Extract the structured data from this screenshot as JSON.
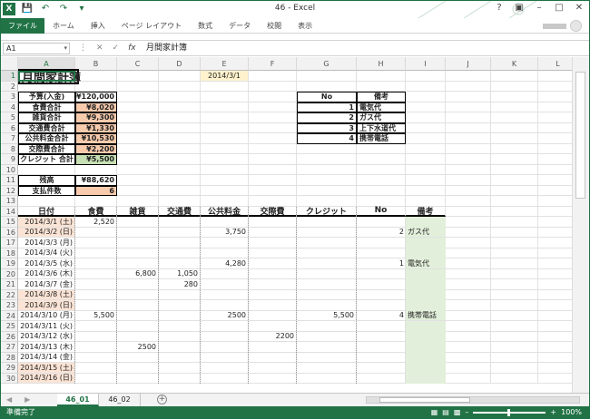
{
  "window": {
    "title": "46 - Excel"
  },
  "ribbon": {
    "tabs": [
      "ファイル",
      "ホーム",
      "挿入",
      "ページ レイアウト",
      "数式",
      "データ",
      "校閲",
      "表示"
    ]
  },
  "formula_bar": {
    "name_box": "A1",
    "formula": "月間家計簿"
  },
  "columns": [
    "A",
    "B",
    "C",
    "D",
    "E",
    "F",
    "G",
    "H",
    "I",
    "J",
    "K",
    "L"
  ],
  "sheet": {
    "title": "月間家計簿",
    "date": "2014/3/1",
    "summary": [
      {
        "label": "予算(入金)",
        "value": "¥120,000"
      },
      {
        "label": "食費合計",
        "value": "¥8,020"
      },
      {
        "label": "雑貨合計",
        "value": "¥9,300"
      },
      {
        "label": "交通費合計",
        "value": "¥1,330"
      },
      {
        "label": "公共料金合計",
        "value": "¥10,530"
      },
      {
        "label": "交際費合計",
        "value": "¥2,200"
      },
      {
        "label": "クレジット 合計",
        "value": "¥5,500"
      }
    ],
    "balance": {
      "label": "残高",
      "value": "¥88,620"
    },
    "payments": {
      "label": "支払件数",
      "value": "6"
    },
    "notes_header": {
      "no": "No",
      "note": "備考"
    },
    "notes": [
      {
        "no": "1",
        "note": "電気代"
      },
      {
        "no": "2",
        "note": "ガス代"
      },
      {
        "no": "3",
        "note": "上下水道代"
      },
      {
        "no": "4",
        "note": "携帯電話"
      }
    ],
    "table_headers": [
      "日付",
      "食費",
      "雑貨",
      "交通費",
      "公共料金",
      "交際費",
      "クレジット",
      "No",
      "備考"
    ],
    "rows": [
      {
        "date": "2014/3/1 (土)",
        "food": "2,520",
        "misc": "",
        "transport": "",
        "utility": "",
        "social": "",
        "credit": "",
        "no": "",
        "note": "",
        "weekend": true
      },
      {
        "date": "2014/3/2 (日)",
        "food": "",
        "misc": "",
        "transport": "",
        "utility": "3,750",
        "social": "",
        "credit": "",
        "no": "2",
        "note": "ガス代",
        "weekend": true
      },
      {
        "date": "2014/3/3 (月)",
        "food": "",
        "misc": "",
        "transport": "",
        "utility": "",
        "social": "",
        "credit": "",
        "no": "",
        "note": "",
        "weekend": false
      },
      {
        "date": "2014/3/4 (火)",
        "food": "",
        "misc": "",
        "transport": "",
        "utility": "",
        "social": "",
        "credit": "",
        "no": "",
        "note": "",
        "weekend": false
      },
      {
        "date": "2014/3/5 (水)",
        "food": "",
        "misc": "",
        "transport": "",
        "utility": "4,280",
        "social": "",
        "credit": "",
        "no": "1",
        "note": "電気代",
        "weekend": false
      },
      {
        "date": "2014/3/6 (木)",
        "food": "",
        "misc": "6,800",
        "transport": "1,050",
        "utility": "",
        "social": "",
        "credit": "",
        "no": "",
        "note": "",
        "weekend": false
      },
      {
        "date": "2014/3/7 (金)",
        "food": "",
        "misc": "",
        "transport": "280",
        "utility": "",
        "social": "",
        "credit": "",
        "no": "",
        "note": "",
        "weekend": false
      },
      {
        "date": "2014/3/8 (土)",
        "food": "",
        "misc": "",
        "transport": "",
        "utility": "",
        "social": "",
        "credit": "",
        "no": "",
        "note": "",
        "weekend": true
      },
      {
        "date": "2014/3/9 (日)",
        "food": "",
        "misc": "",
        "transport": "",
        "utility": "",
        "social": "",
        "credit": "",
        "no": "",
        "note": "",
        "weekend": true
      },
      {
        "date": "2014/3/10 (月)",
        "food": "5,500",
        "misc": "",
        "transport": "",
        "utility": "2500",
        "social": "",
        "credit": "5,500",
        "no": "4",
        "note": "携帯電話",
        "weekend": false
      },
      {
        "date": "2014/3/11 (火)",
        "food": "",
        "misc": "",
        "transport": "",
        "utility": "",
        "social": "",
        "credit": "",
        "no": "",
        "note": "",
        "weekend": false
      },
      {
        "date": "2014/3/12 (水)",
        "food": "",
        "misc": "",
        "transport": "",
        "utility": "",
        "social": "2200",
        "credit": "",
        "no": "",
        "note": "",
        "weekend": false
      },
      {
        "date": "2014/3/13 (木)",
        "food": "",
        "misc": "2500",
        "transport": "",
        "utility": "",
        "social": "",
        "credit": "",
        "no": "",
        "note": "",
        "weekend": false
      },
      {
        "date": "2014/3/14 (金)",
        "food": "",
        "misc": "",
        "transport": "",
        "utility": "",
        "social": "",
        "credit": "",
        "no": "",
        "note": "",
        "weekend": false
      },
      {
        "date": "2014/3/15 (土)",
        "food": "",
        "misc": "",
        "transport": "",
        "utility": "",
        "social": "",
        "credit": "",
        "no": "",
        "note": "",
        "weekend": true
      },
      {
        "date": "2014/3/16 (日)",
        "food": "",
        "misc": "",
        "transport": "",
        "utility": "",
        "social": "",
        "credit": "",
        "no": "",
        "note": "",
        "weekend": true
      }
    ]
  },
  "sheet_tabs": [
    "46_01",
    "46_02"
  ],
  "status": {
    "text": "準備完了",
    "zoom": "100%"
  }
}
